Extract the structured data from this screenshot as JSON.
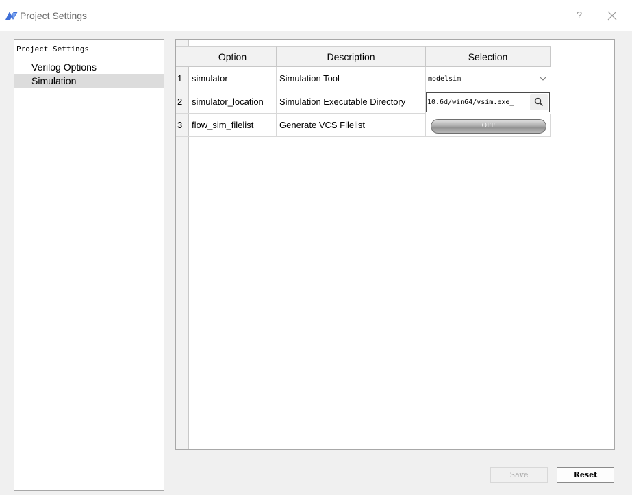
{
  "window": {
    "title": "Project Settings",
    "help": "?",
    "icon": "app-logo-icon",
    "close_icon": "close-icon"
  },
  "tree": {
    "root": "Project Settings",
    "items": [
      {
        "label": "Verilog Options",
        "selected": false
      },
      {
        "label": "Simulation",
        "selected": true
      }
    ]
  },
  "table": {
    "headers": [
      "Option",
      "Description",
      "Selection"
    ],
    "rows": [
      {
        "num": "1",
        "option": "simulator",
        "description": "Simulation Tool",
        "selection": "modelsim",
        "control": "dropdown"
      },
      {
        "num": "2",
        "option": "simulator_location",
        "description": "Simulation Executable Directory",
        "selection": "_10.6d/win64/vsim.exe",
        "control": "path-browse"
      },
      {
        "num": "3",
        "option": "flow_sim_filelist",
        "description": "Generate VCS Filelist",
        "selection": "OFF",
        "control": "toggle"
      }
    ]
  },
  "buttons": {
    "save": "Save",
    "reset": "Reset"
  },
  "colors": {
    "selection_highlight": "#dcdcdc",
    "toggle_off": "#a8a8a8",
    "logo": "#3f6fd8"
  }
}
